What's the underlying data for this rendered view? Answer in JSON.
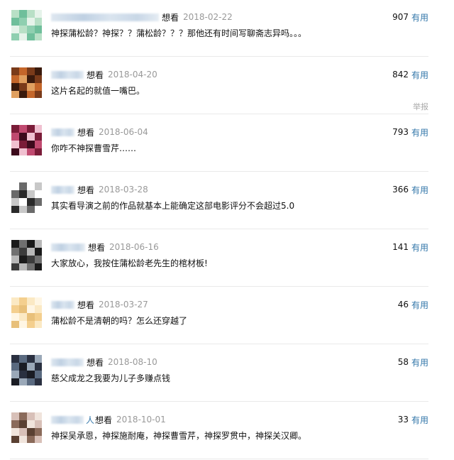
{
  "comments": [
    {
      "uname_tail": "",
      "rating": "想看",
      "date": "2018-02-22",
      "content": "神探蒲松龄？神探？？蒲松龄？？？那他还有时间写聊斋志异吗。。。",
      "votes": "907",
      "useful": "有用",
      "report": "",
      "avatar_colors": [
        "#b8e0c6",
        "#6fbf9b",
        "#e6f3ea",
        "#8fcfb0"
      ]
    },
    {
      "uname_tail": "",
      "rating": "想看",
      "date": "2018-04-20",
      "content": "这片名起的就值一嘴巴。",
      "votes": "842",
      "useful": "有用",
      "report": "举报",
      "avatar_colors": [
        "#7a3b1a",
        "#c4662a",
        "#3a1a0c",
        "#e0a060"
      ]
    },
    {
      "uname_tail": "",
      "rating": "想看",
      "date": "2018-06-04",
      "content": "你咋不神探曹雪芹……",
      "votes": "793",
      "useful": "有用",
      "report": "",
      "avatar_colors": [
        "#7a1c38",
        "#c04a70",
        "#f0c0d0",
        "#3c0a1c"
      ]
    },
    {
      "uname_tail": "",
      "rating": "想看",
      "date": "2018-03-28",
      "content": "其实看导演之前的作品就基本上能确定这部电影评分不会超过5.0",
      "votes": "366",
      "useful": "有用",
      "report": "",
      "avatar_colors": [
        "#ffffff",
        "#6a6a6a",
        "#c8c8c8",
        "#2a2a2a"
      ]
    },
    {
      "uname_tail": "",
      "rating": "想看",
      "date": "2018-06-16",
      "content": "大家放心，我按住蒲松龄老先生的棺材板!",
      "votes": "141",
      "useful": "有用",
      "report": "",
      "avatar_colors": [
        "#1a1a1a",
        "#707070",
        "#b8b8b8",
        "#3c3c3c"
      ]
    },
    {
      "uname_tail": "",
      "rating": "想看",
      "date": "2018-03-27",
      "content": "蒲松龄不是清朝的吗？怎么还穿越了",
      "votes": "46",
      "useful": "有用",
      "report": "",
      "avatar_colors": [
        "#fbe9c4",
        "#f4cf8e",
        "#fff6e4",
        "#e8c07a"
      ]
    },
    {
      "uname_tail": "",
      "rating": "想看",
      "date": "2018-08-10",
      "content": "慈父成龙之我要为儿子多赚点钱",
      "votes": "58",
      "useful": "有用",
      "report": "",
      "avatar_colors": [
        "#2a3040",
        "#5a6a80",
        "#9aa8b8",
        "#1a1c24"
      ]
    },
    {
      "uname_tail": "人",
      "rating": "想看",
      "date": "2018-10-01",
      "content": "神探吴承恩，神探施耐庵，神探曹雪芹，神探罗贯中，神探关汉卿。",
      "votes": "33",
      "useful": "有用",
      "report": "",
      "avatar_colors": [
        "#d8c0b8",
        "#8a6a5a",
        "#f0e4dc",
        "#5a4032"
      ]
    }
  ]
}
